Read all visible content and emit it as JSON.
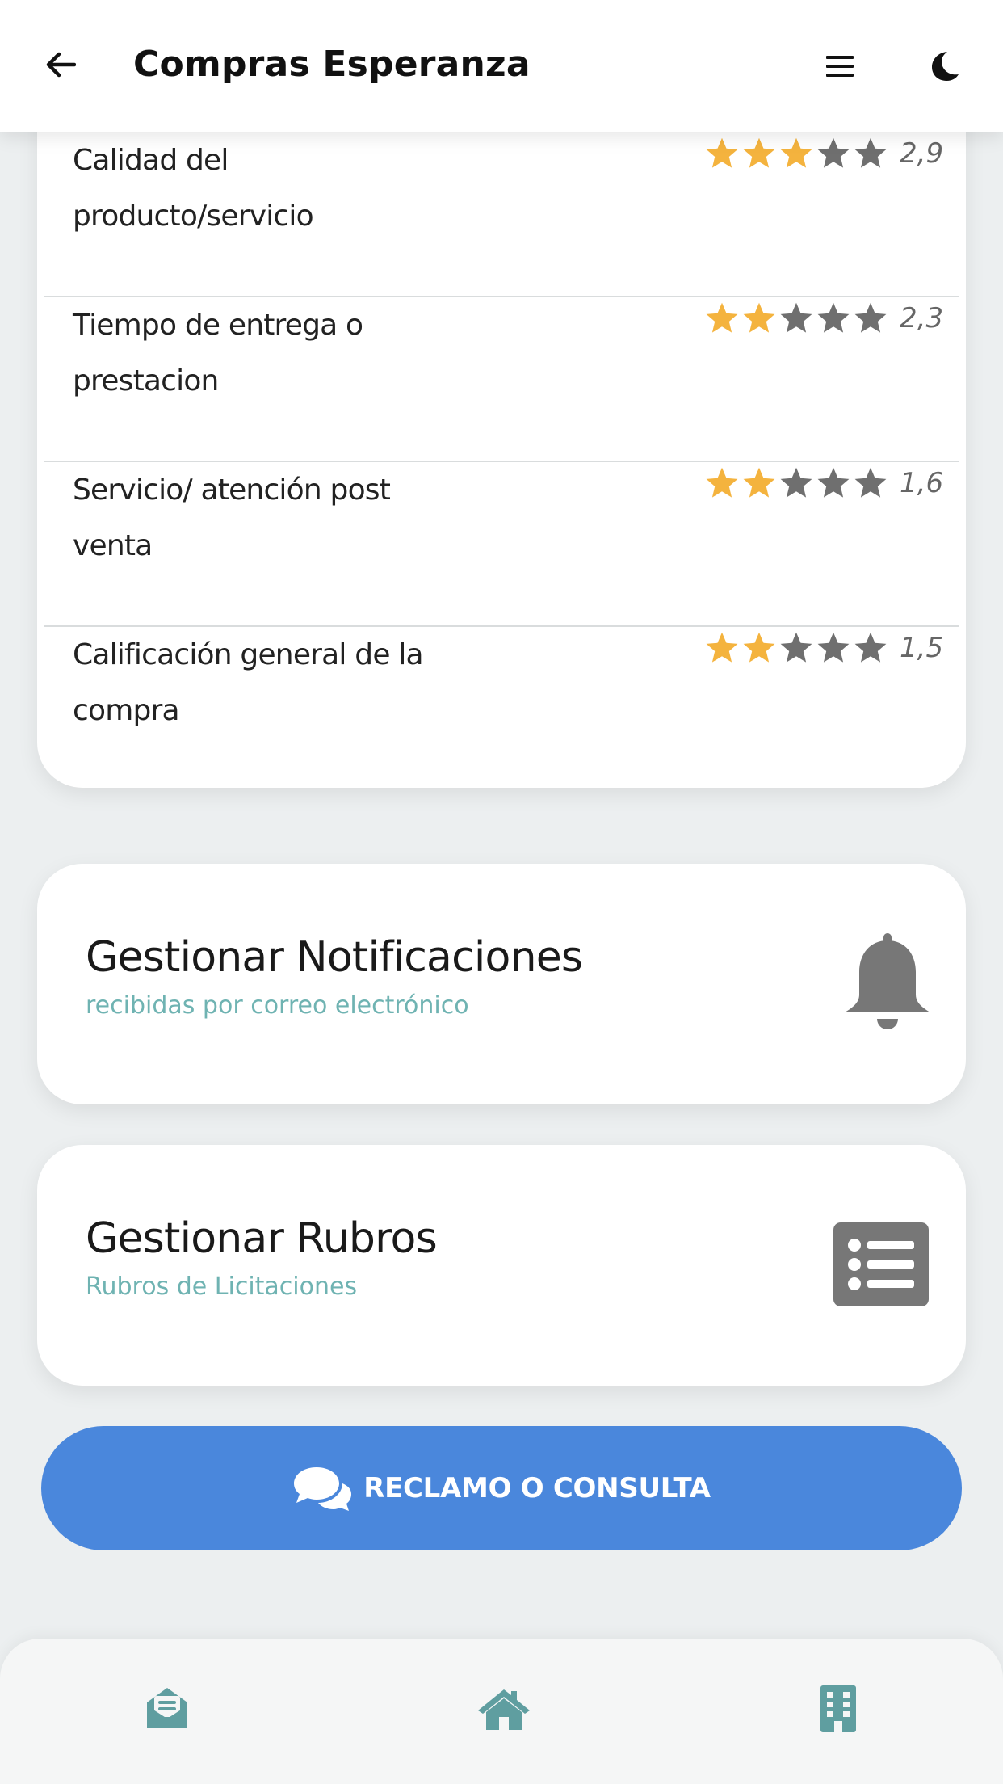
{
  "header": {
    "title": "Compras Esperanza",
    "icons": {
      "back": "arrow-left-icon",
      "menu": "hamburger-menu-icon",
      "theme": "moon-icon"
    }
  },
  "ratings": [
    {
      "label": "Calidad del producto/servicio",
      "value_text": "2,9",
      "filled_stars": 3,
      "max_stars": 5
    },
    {
      "label": "Tiempo de entrega o prestacion",
      "value_text": "2,3",
      "filled_stars": 2,
      "max_stars": 5
    },
    {
      "label": "Servicio/ atención post venta",
      "value_text": "1,6",
      "filled_stars": 2,
      "max_stars": 5
    },
    {
      "label": "Calificación general de la compra",
      "value_text": "1,5",
      "filled_stars": 2,
      "max_stars": 5
    }
  ],
  "notifications_card": {
    "title": "Gestionar Notificaciones",
    "subtitle": "recibidas por correo electrónico",
    "icon": "bell-icon"
  },
  "rubros_card": {
    "title": "Gestionar Rubros",
    "subtitle": "Rubros de Licitaciones",
    "icon": "list-icon"
  },
  "cta": {
    "label": "RECLAMO O CONSULTA",
    "icon": "chat-bubbles-icon"
  },
  "bottom_nav": {
    "items": [
      {
        "icon": "mail-open-icon"
      },
      {
        "icon": "home-icon"
      },
      {
        "icon": "building-icon"
      }
    ]
  },
  "colors": {
    "star_filled": "#f4b33e",
    "star_empty": "#6f6f6f",
    "accent_teal": "#5f9ea0",
    "subtitle_teal": "#6fb3b2",
    "cta_blue": "#4a87dc",
    "icon_gray": "#777777"
  }
}
